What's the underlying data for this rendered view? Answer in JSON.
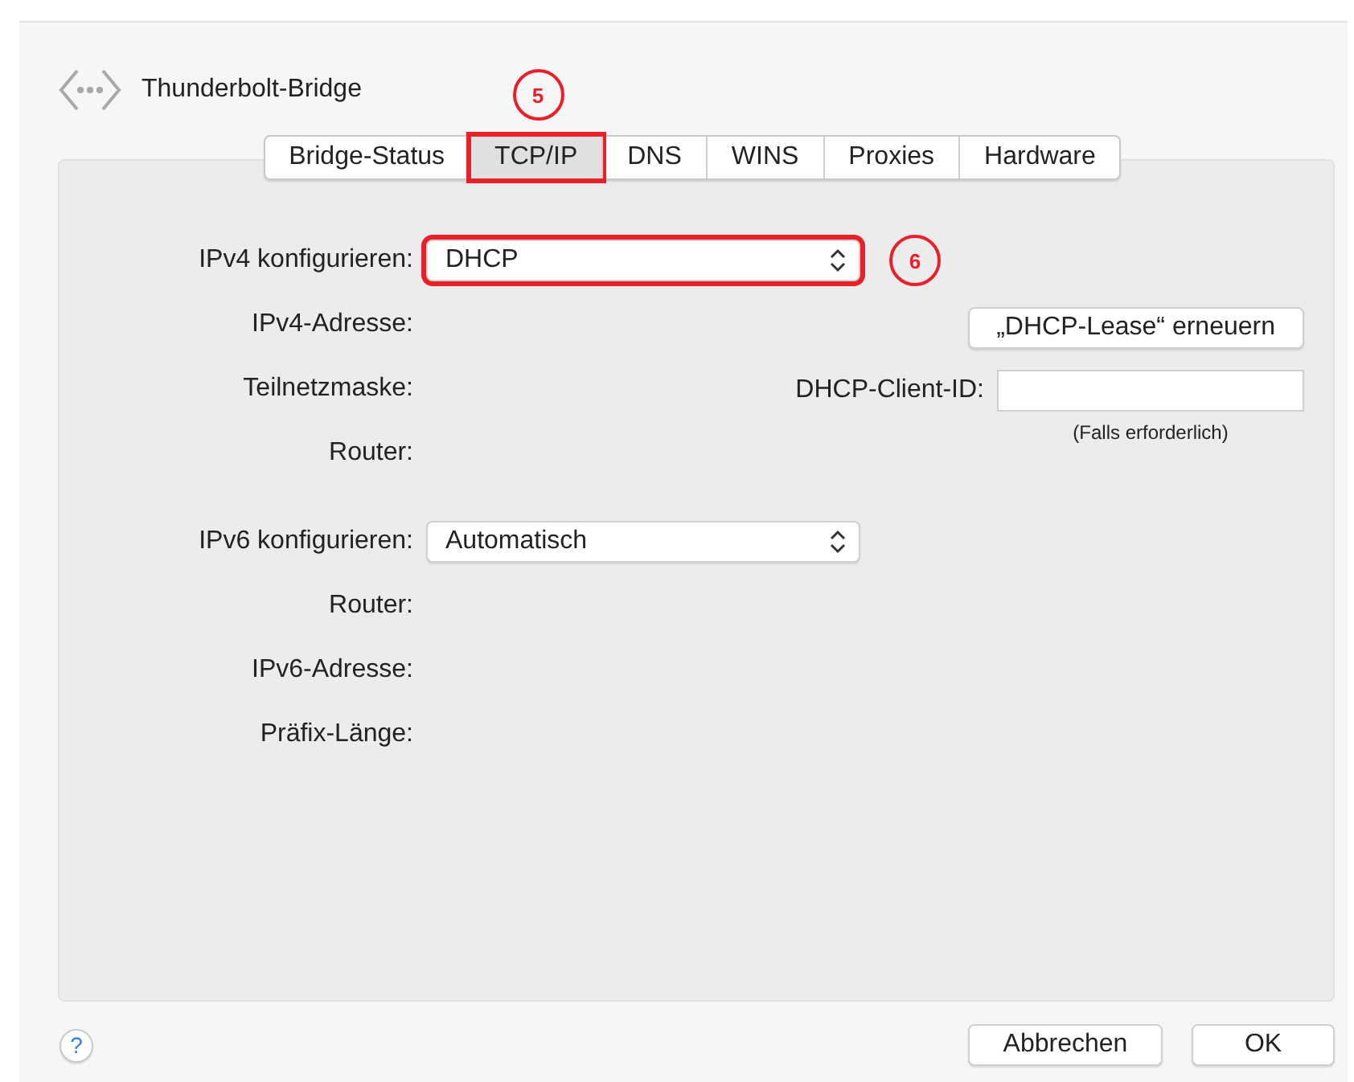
{
  "header": {
    "title": "Thunderbolt-Bridge"
  },
  "tabs": [
    {
      "label": "Bridge-Status",
      "selected": false,
      "highlighted": false
    },
    {
      "label": "TCP/IP",
      "selected": true,
      "highlighted": true,
      "callout": "5"
    },
    {
      "label": "DNS",
      "selected": false,
      "highlighted": false
    },
    {
      "label": "WINS",
      "selected": false,
      "highlighted": false
    },
    {
      "label": "Proxies",
      "selected": false,
      "highlighted": false
    },
    {
      "label": "Hardware",
      "selected": false,
      "highlighted": false
    }
  ],
  "ipv4": {
    "label": "IPv4 konfigurieren:",
    "value": "DHCP",
    "highlighted": true,
    "callout": "6",
    "fields": [
      {
        "label": "IPv4-Adresse:"
      },
      {
        "label": "Teilnetzmaske:"
      },
      {
        "label": "Router:"
      }
    ],
    "renew_button": "„DHCP-Lease“ erneuern",
    "client_id": {
      "label": "DHCP-Client-ID:",
      "hint": "(Falls erforderlich)"
    }
  },
  "ipv6": {
    "label": "IPv6 konfigurieren:",
    "value": "Automatisch",
    "highlighted": false,
    "fields": [
      {
        "label": "Router:"
      },
      {
        "label": "IPv6-Adresse:"
      },
      {
        "label": "Präfix-Länge:"
      }
    ]
  },
  "help": "?",
  "buttons": [
    {
      "label": "Abbrechen",
      "kind": "cancel"
    },
    {
      "label": "OK",
      "kind": "ok"
    }
  ]
}
